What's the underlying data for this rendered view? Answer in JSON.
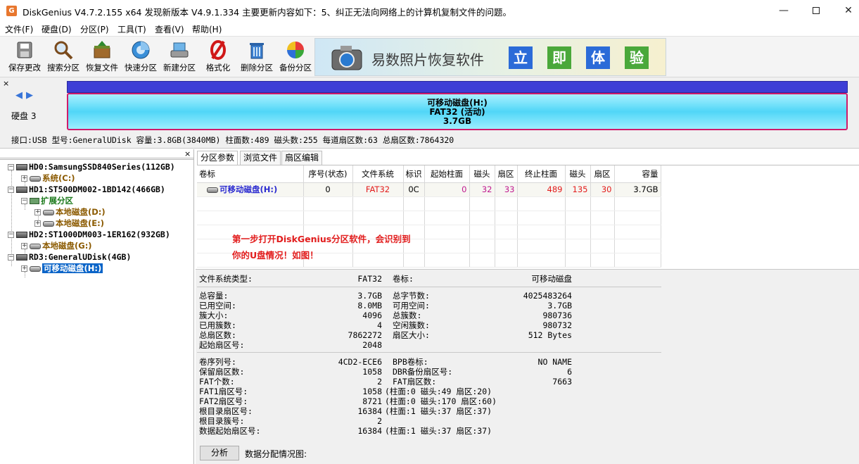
{
  "window": {
    "app_icon": "G",
    "title": "DiskGenius V4.7.2.155 x64    发现新版本 V4.9.1.334 主要更新内容如下：5、纠正无法向网络上的计算机复制文件的问题。",
    "minimize": "—",
    "maximize": "",
    "close": "✕"
  },
  "menu": [
    "文件(F)",
    "硬盘(D)",
    "分区(P)",
    "工具(T)",
    "查看(V)",
    "帮助(H)"
  ],
  "toolbar": {
    "buttons": [
      {
        "label": "保存更改",
        "icon": "save-icon"
      },
      {
        "label": "搜索分区",
        "icon": "magnifier-icon"
      },
      {
        "label": "恢复文件",
        "icon": "recover-box-icon"
      },
      {
        "label": "快速分区",
        "icon": "quick-partition-icon"
      },
      {
        "label": "新建分区",
        "icon": "new-partition-icon"
      },
      {
        "label": "格式化",
        "icon": "format-icon"
      },
      {
        "label": "删除分区",
        "icon": "trash-icon"
      },
      {
        "label": "备份分区",
        "icon": "backup-pie-icon"
      }
    ],
    "banner": {
      "text": "易数照片恢复软件",
      "boxes": [
        "立",
        "即",
        "体",
        "验"
      ]
    }
  },
  "disk_map": {
    "close": "×",
    "nav_left": "◀",
    "nav_right": "▶",
    "disk_label": "硬盘 3",
    "partition_name": "可移动磁盘(H:)",
    "partition_fs": "FAT32 (活动)",
    "partition_size": "3.7GB",
    "info": "接口:USB  型号:GeneralUDisk  容量:3.8GB(3840MB)  柱面数:489  磁头数:255  每道扇区数:63  总扇区数:7864320"
  },
  "tree": {
    "close": "×",
    "nodes": [
      {
        "label": "HD0:SamsungSSD840Series(112GB)"
      },
      {
        "label": "系统(C:)"
      },
      {
        "label": "HD1:ST500DM002-1BD142(466GB)"
      },
      {
        "label": "扩展分区"
      },
      {
        "label": "本地磁盘(D:)"
      },
      {
        "label": "本地磁盘(E:)"
      },
      {
        "label": "HD2:ST1000DM003-1ER162(932GB)"
      },
      {
        "label": "本地磁盘(G:)"
      },
      {
        "label": "RD3:GeneralUDisk(4GB)"
      },
      {
        "label": "可移动磁盘(H:)"
      }
    ]
  },
  "tabs": [
    "分区参数",
    "浏览文件",
    "扇区编辑"
  ],
  "partition_table": {
    "headers": [
      "卷标",
      "序号(状态)",
      "文件系统",
      "标识",
      "起始柱面",
      "磁头",
      "扇区",
      "终止柱面",
      "磁头",
      "扇区",
      "容量"
    ],
    "rows": [
      [
        "可移动磁盘(H:)",
        "0",
        "FAT32",
        "0C",
        "0",
        "32",
        "33",
        "489",
        "135",
        "30",
        "3.7GB"
      ]
    ]
  },
  "annotation": [
    "第一步打开DiskGenius分区软件，会识别到",
    "你的U盘情况！如图！"
  ],
  "info": {
    "fs_type_label": "文件系统类型:",
    "fs_type_value": "FAT32",
    "volume_label_label": "卷标:",
    "volume_label_value": "可移动磁盘",
    "group1_left": [
      [
        "总容量:",
        "3.7GB"
      ],
      [
        "已用空间:",
        "8.0MB"
      ],
      [
        "簇大小:",
        "4096"
      ],
      [
        "已用簇数:",
        "4"
      ],
      [
        "总扇区数:",
        "7862272"
      ],
      [
        "起始扇区号:",
        "2048"
      ]
    ],
    "group1_right": [
      [
        "总字节数:",
        "4025483264"
      ],
      [
        "可用空间:",
        "3.7GB"
      ],
      [
        "总簇数:",
        "980736"
      ],
      [
        "空闲簇数:",
        "980732"
      ],
      [
        "扇区大小:",
        "512 Bytes"
      ]
    ],
    "group2_left": [
      [
        "卷序列号:",
        "4CD2-ECE6"
      ],
      [
        "保留扇区数:",
        "1058"
      ],
      [
        "FAT个数:",
        "2"
      ],
      [
        "FAT1扇区号:",
        "1058 (柱面:0 磁头:49 扇区:20)"
      ],
      [
        "FAT2扇区号:",
        "8721 (柱面:0 磁头:170 扇区:60)"
      ],
      [
        "根目录扇区号:",
        "16384 (柱面:1 磁头:37 扇区:37)"
      ],
      [
        "根目录簇号:",
        "2"
      ],
      [
        "数据起始扇区号:",
        "16384 (柱面:1 磁头:37 扇区:37)"
      ]
    ],
    "group2_right": [
      [
        "BPB卷标:",
        "NO NAME"
      ],
      [
        "DBR备份扇区号:",
        "6"
      ],
      [
        "FAT扇区数:",
        "7663"
      ]
    ]
  },
  "bottom": {
    "analyze_button": "分析",
    "distribution_label": "数据分配情况图:"
  }
}
